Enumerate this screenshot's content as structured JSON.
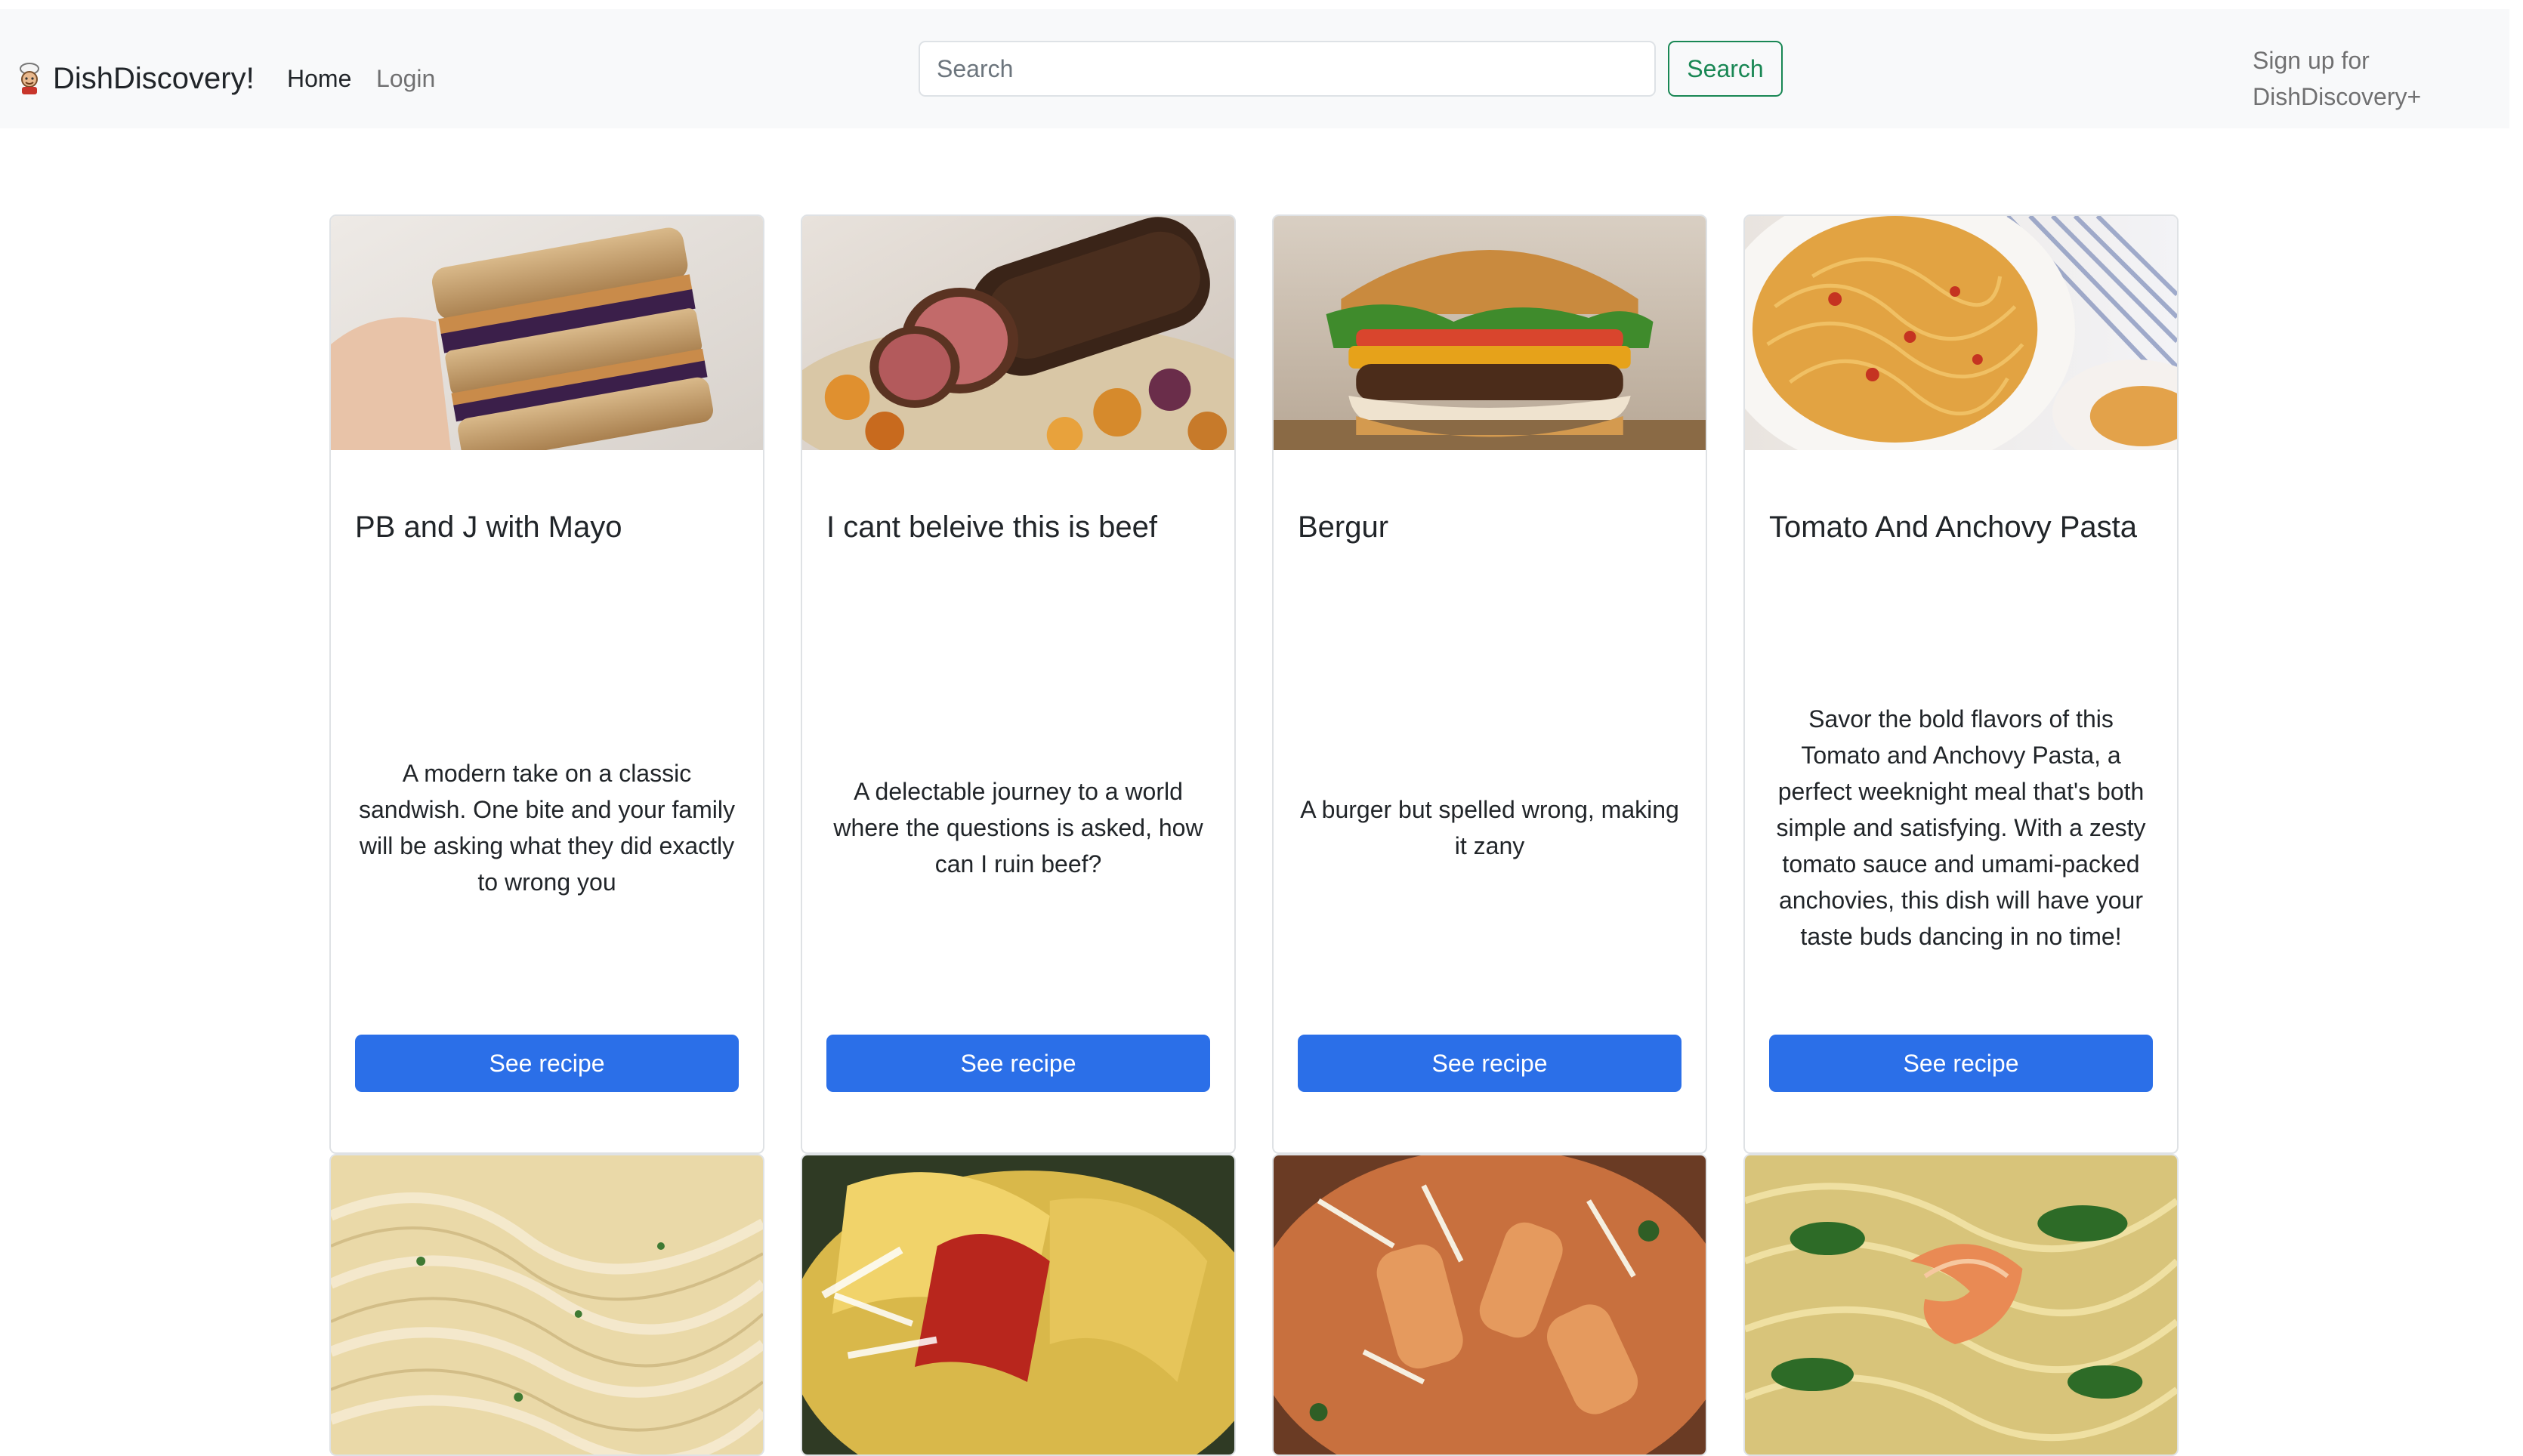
{
  "navbar": {
    "brand": "DishDiscovery!",
    "links": [
      {
        "label": "Home",
        "active": true
      },
      {
        "label": "Login",
        "active": false
      }
    ],
    "search": {
      "placeholder": "Search",
      "value": "",
      "button_label": "Search"
    },
    "signup_label": "Sign up for DishDiscovery+"
  },
  "colors": {
    "primary_button": "#2b6fe8",
    "search_button": "#198754",
    "navbar_bg": "#f8f9fa"
  },
  "cards": [
    {
      "title": "PB and J with Mayo",
      "description": "A modern take on a classic sandwish. One bite and your family will be asking what they did exactly to wrong you",
      "button_label": "See recipe",
      "image": "pb-and-j-sandwich-photo"
    },
    {
      "title": "I cant beleive this is beef",
      "description": "A delectable journey to a world where the questions is asked, how can I ruin beef?",
      "button_label": "See recipe",
      "image": "sliced-roast-beef-photo"
    },
    {
      "title": "Bergur",
      "description": "A burger but spelled wrong, making it zany",
      "button_label": "See recipe",
      "image": "burger-photo"
    },
    {
      "title": "Tomato And Anchovy Pasta",
      "description": "Savor the bold flavors of this Tomato and Anchovy Pasta, a perfect weeknight meal that's both simple and satisfying. With a zesty tomato sauce and umami-packed anchovies, this dish will have your taste buds dancing in no time!",
      "button_label": "See recipe",
      "image": "spaghetti-photo"
    }
  ],
  "cards_row2": [
    {
      "image": "fettuccine-alfredo-photo"
    },
    {
      "image": "pappardelle-tomato-photo"
    },
    {
      "image": "penne-parmesan-photo"
    },
    {
      "image": "shrimp-linguine-photo"
    }
  ]
}
